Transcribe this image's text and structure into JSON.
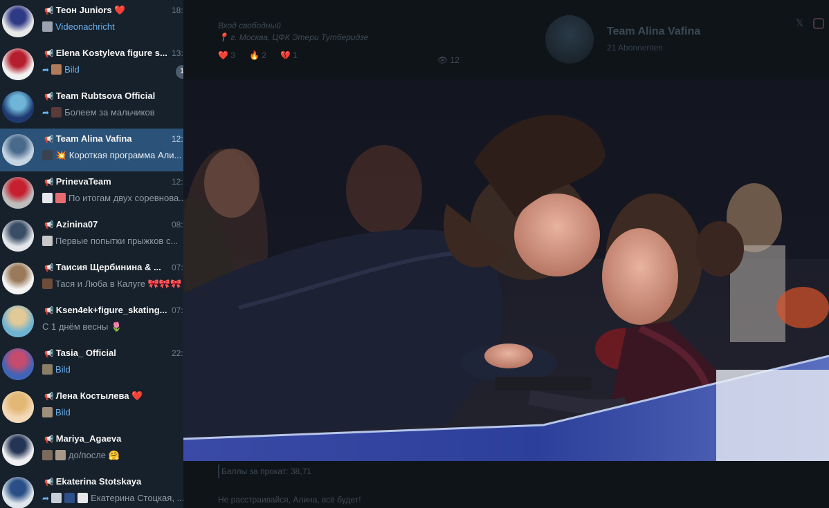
{
  "chats": [
    {
      "title": "Теон Juniors ❤️",
      "time": "18:",
      "preview": "Videonachricht",
      "preview_link": true,
      "badge": "",
      "thumbs": [
        "#9aa3ad"
      ],
      "forwarded": false,
      "avatar_colors": [
        "#e8e8e8",
        "#2f3a86"
      ]
    },
    {
      "title": "Elena Kostyleva figure s...",
      "time": "13:",
      "preview": "Bild",
      "preview_link": true,
      "badge": "1",
      "thumbs": [
        "#b07b5b"
      ],
      "forwarded": true,
      "avatar_colors": [
        "#f1f1f1",
        "#b51e2e"
      ]
    },
    {
      "title": "Team Rubtsova Official",
      "time": "",
      "preview": "Болеем за мальчиков",
      "preview_link": false,
      "badge": "",
      "thumbs": [
        "#5a3a3a"
      ],
      "forwarded": true,
      "avatar_colors": [
        "#1e3a70",
        "#6fb5d8"
      ]
    },
    {
      "title": "Team Alina Vafina",
      "time": "12:",
      "preview": "💥 Короткая программа Али...",
      "preview_link": false,
      "badge": "",
      "thumbs": [
        "#3b4350"
      ],
      "forwarded": false,
      "avatar_colors": [
        "#c5d4e2",
        "#4a6a8c"
      ]
    },
    {
      "title": "PrinevaTeam",
      "time": "12:",
      "preview": "По итогам двух соревнова...",
      "preview_link": false,
      "badge": "",
      "thumbs": [
        "#e6e6ee",
        "#e96b72"
      ],
      "forwarded": false,
      "avatar_colors": [
        "#bdbdbd",
        "#c61f2d"
      ]
    },
    {
      "title": "Azinina07",
      "time": "08:",
      "preview": "Первые попытки прыжков с...",
      "preview_link": false,
      "badge": "",
      "thumbs": [
        "#c7c7c7"
      ],
      "forwarded": false,
      "avatar_colors": [
        "#e4e6ea",
        "#3a4d66"
      ]
    },
    {
      "title": "Таисия Щербинина & ...",
      "time": "07:",
      "preview": "Тася и Люба в Калуге 🎀🎀🎀",
      "preview_link": false,
      "badge": "",
      "thumbs": [
        "#6e4c3a"
      ],
      "forwarded": false,
      "avatar_colors": [
        "#f4f4f4",
        "#9a7a5a"
      ]
    },
    {
      "title": "Ksen4ek+figure_skating...",
      "time": "07:",
      "preview": "С 1 днём весны 🌷",
      "preview_link": false,
      "badge": "",
      "thumbs": [],
      "forwarded": false,
      "avatar_colors": [
        "#6fb3d3",
        "#e2c998"
      ]
    },
    {
      "title": "Tasia_ Official",
      "time": "22:",
      "preview": "Bild",
      "preview_link": true,
      "badge": "",
      "thumbs": [
        "#8a7e66"
      ],
      "forwarded": false,
      "avatar_colors": [
        "#3f65b8",
        "#c54b6f"
      ]
    },
    {
      "title": "Лена Костылева ❤️",
      "time": "",
      "preview": "Bild",
      "preview_link": true,
      "badge": "",
      "thumbs": [
        "#9e8f7d"
      ],
      "forwarded": false,
      "avatar_colors": [
        "#f3d9b8",
        "#e3b774"
      ]
    },
    {
      "title": "Mariya_Agaeva",
      "time": "",
      "preview": "до/после 🤗",
      "preview_link": false,
      "badge": "",
      "thumbs": [
        "#7c6a5b",
        "#a89888"
      ],
      "forwarded": false,
      "avatar_colors": [
        "#f0f0f2",
        "#243455"
      ]
    },
    {
      "title": "Ekaterina Stotskaya",
      "time": "",
      "preview": "Екатерина Стоцкая, ...",
      "preview_link": false,
      "badge": "",
      "thumbs": [
        "#c6cfd8",
        "#2d4f8a",
        "#e8e8e8"
      ],
      "forwarded": true,
      "avatar_colors": [
        "#dfe6ec",
        "#2a4f86"
      ]
    }
  ],
  "background": {
    "post_lines": [
      "Вход свободный",
      "📍 г. Москва, ЦФК Этери Тутберидзе"
    ],
    "reactions": [
      "❤️ 3",
      "🔥 2",
      "💔 1"
    ],
    "views": "12",
    "channel_title": "Team Alina Vafina",
    "channel_sub": "21 Abonnenten",
    "score_line": "Баллы за прокат: 38,71",
    "comment_line": "Не расстраивайся, Алина, всё будет!"
  },
  "icons": {
    "channel": "megaphone-icon",
    "forward": "forward-arrow-icon",
    "x_social": "x-logo-icon",
    "instagram": "instagram-icon",
    "views": "eye-icon"
  }
}
